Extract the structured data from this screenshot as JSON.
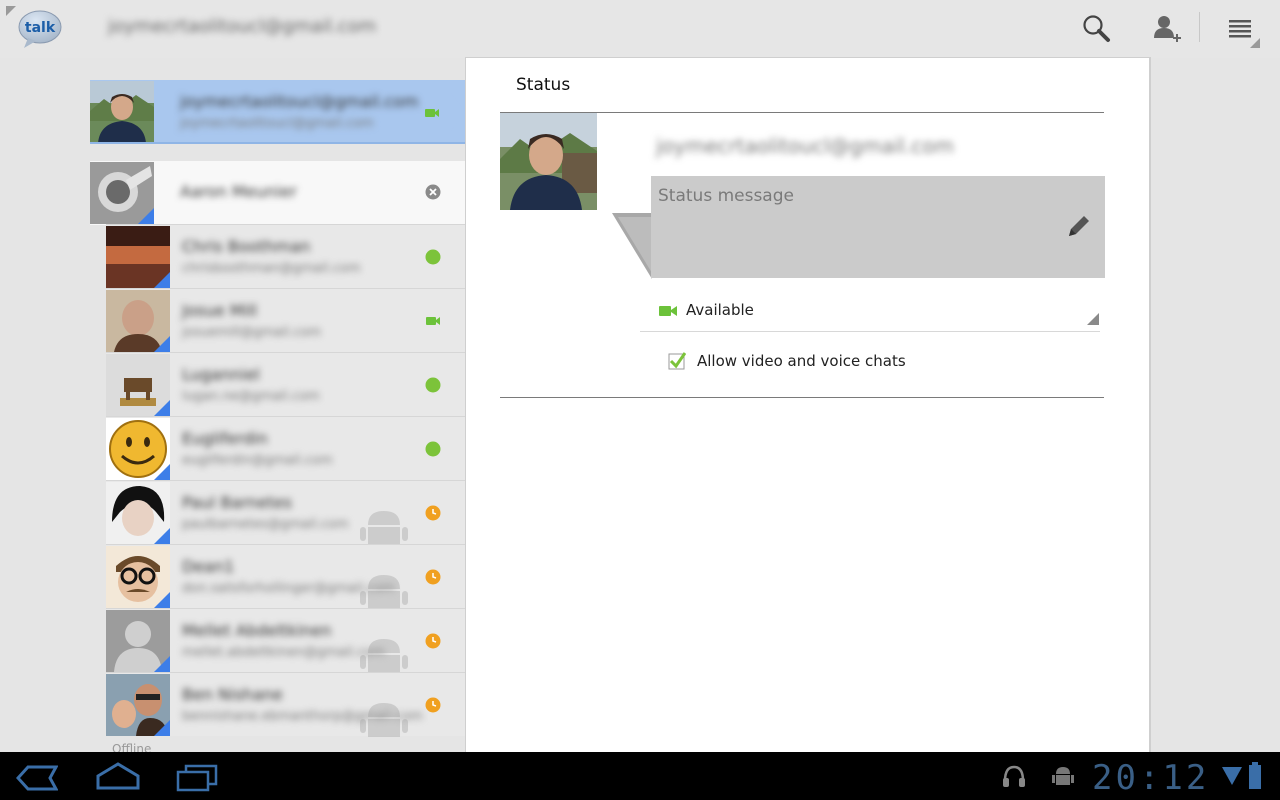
{
  "header": {
    "app_logo_text": "talk",
    "account_email": "joymecrtaolitoucl@gmail.com",
    "icons": [
      "search-icon",
      "add-contact-icon",
      "menu-icon"
    ]
  },
  "contacts": {
    "self": {
      "name": "joymecrtaolitoucl@gmail.com",
      "sub": "joymecrtaolitoucl@gmail.com",
      "status": "video-available"
    },
    "expanded": {
      "name": "Aaron Meunier",
      "status": "remove"
    },
    "items": [
      {
        "name": "Chris Boothman",
        "sub": "chrisboothman@gmail.com",
        "status": "available"
      },
      {
        "name": "Josue Mill",
        "sub": "josuemill@gmail.com",
        "status": "video-available"
      },
      {
        "name": "Luganniel",
        "sub": "lugan.ne@gmail.com",
        "status": "available"
      },
      {
        "name": "Eugliferdin",
        "sub": "eugliferdin@gmail.com",
        "status": "available"
      },
      {
        "name": "Paul Barnetes",
        "sub": "paulbarnetes@gmail.com",
        "status": "away"
      },
      {
        "name": "Dean1",
        "sub": "don.salisforhollinger@gmail.com",
        "status": "away"
      },
      {
        "name": "Mellet Abdeltkinen",
        "sub": "mellet.abdeltkinen@gmail.com",
        "status": "away"
      },
      {
        "name": "Ben Nishane",
        "sub": "bennishane.ebmanthorp@gmail.com",
        "status": "away"
      }
    ],
    "offline_label": "Offline"
  },
  "status_panel": {
    "title": "Status",
    "email": "joymecrtaolitoucl@gmail.com",
    "message_placeholder": "Status message",
    "availability": "Available",
    "allow_video_label": "Allow video and voice chats",
    "allow_video_checked": true
  },
  "system_bar": {
    "clock": "20:12",
    "colors": {
      "accent": "#3d7ee8",
      "available": "#7cc33a",
      "away": "#f0a020"
    }
  }
}
